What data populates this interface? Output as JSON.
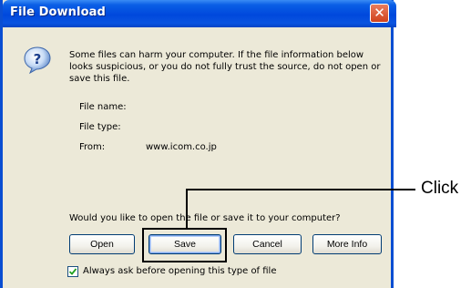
{
  "window": {
    "title": "File Download",
    "close_glyph": "✕",
    "close_icon": "close-icon",
    "question_icon": "question-icon"
  },
  "message": {
    "line1": "Some files can harm your computer. If the file information below",
    "line2": "looks suspicious, or you do not fully trust the source, do not open or",
    "line3": "save this file."
  },
  "file_info": {
    "name_label": "File name:",
    "type_label": "File type:",
    "from_label": "From:",
    "from_value": "www.icom.co.jp"
  },
  "prompt": "Would you like to open the file or save it to your computer?",
  "buttons": {
    "open": "Open",
    "save": "Save",
    "cancel": "Cancel",
    "more_info": "More Info"
  },
  "checkbox": {
    "label": "Always ask before opening this type of file",
    "checked": true
  },
  "annotation": {
    "label": "Click"
  },
  "colors": {
    "title_bar": "#0048dc",
    "dialog_bg": "#ece9d8",
    "close_button": "#d1421c",
    "button_border": "#003c74"
  }
}
